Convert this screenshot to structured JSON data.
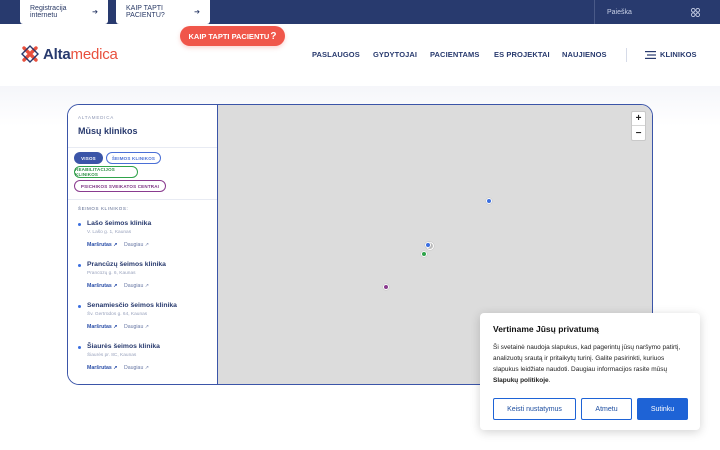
{
  "topbar": {
    "tab_register": "Registracija internetu",
    "tab_patient": "KAIP TAPTI PACIENTU?",
    "search_placeholder": "Paieška",
    "search_icon": "search-icon"
  },
  "header": {
    "logo_part1": "Alta",
    "logo_part2": "medica",
    "cta_label": "KAIP TAPTI PACIENTU",
    "cta_mark": "?",
    "nav": [
      "PASLAUGOS",
      "GYDYTOJAI",
      "PACIENTAMS",
      "ES PROJEKTAI",
      "NAUJIENOS"
    ],
    "clinics_menu": "KLINIKOS"
  },
  "sidebar": {
    "brand": "ALTAMEDICA",
    "title": "Mūsų klinikos",
    "filters": {
      "all": "VISOS",
      "family": "ŠEIMOS KLINIKOS",
      "rehab": "REABILITACIJOS KLINIKOS",
      "mental": "PSICHIKOS SVEIKATOS CENTRAI"
    },
    "category": "ŠEIMOS KLINIKOS:",
    "clinics": [
      {
        "name": "Lašo šeimos klinika",
        "address": "V. Lašo g. 1, Kaunas",
        "route": "Maršrutas ↗",
        "more": "Daugiau ↗"
      },
      {
        "name": "Prancūzų šeimos klinika",
        "address": "Prancūzų g. 6, Kaunas",
        "route": "Maršrutas ↗",
        "more": "Daugiau ↗"
      },
      {
        "name": "Senamiesčio šeimos klinika",
        "address": "Šv. Gertrūdos g. 64, Kaunas",
        "route": "Maršrutas ↗",
        "more": "Daugiau ↗"
      },
      {
        "name": "Šiaurės šeimos klinika",
        "address": "Šiaurės pr. 8C, Kaunas",
        "route": "Maršrutas ↗",
        "more": "Daugiau ↗"
      }
    ]
  },
  "map": {
    "zoom_in": "+",
    "zoom_out": "−",
    "marker_colors": {
      "family": "#3b6fe0",
      "rehab": "#2fa34a",
      "mental": "#8a3b8f"
    }
  },
  "cookie": {
    "title": "Vertiname Jūsų privatumą",
    "body": "Ši svetainė naudoja slapukus, kad pagerintų jūsų naršymo patirtį, analizuotų srautą ir pritaikytų turinį. Galite pasirinkti, kuriuos slapukus leidžiate naudoti. Daugiau informacijos rasite mūsų",
    "policy_link": "Slapukų politikoje",
    "body_end": ".",
    "btn_settings": "Keisti nustatymus",
    "btn_reject": "Atmetu",
    "btn_accept": "Sutinku"
  },
  "colors": {
    "navy": "#283a6e",
    "accent": "#f0564a",
    "blue": "#1e63d6"
  }
}
